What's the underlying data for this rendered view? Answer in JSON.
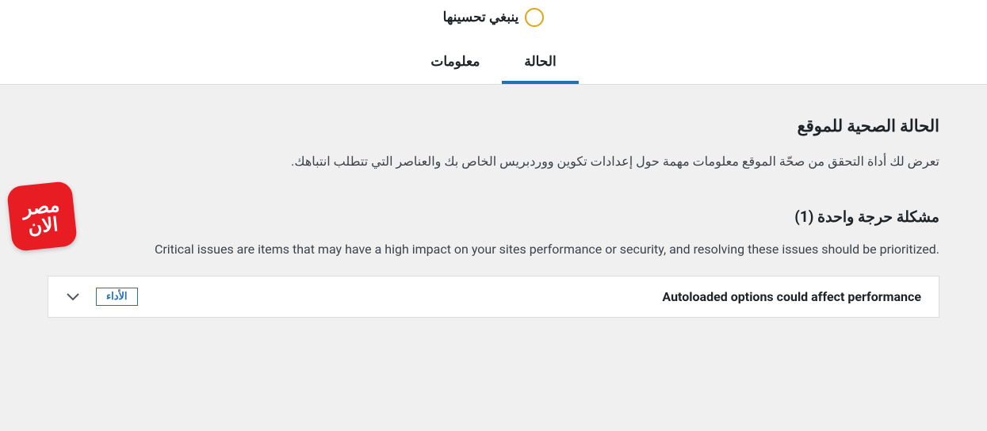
{
  "status": {
    "label": "ينبغي تحسينها"
  },
  "tabs": {
    "status": "الحالة",
    "info": "معلومات"
  },
  "siteHealth": {
    "title": "الحالة الصحية للموقع",
    "description": "تعرض لك أداة التحقق من صحّة الموقع معلومات مهمة حول إعدادات تكوين ووردبريس الخاص بك والعناصر التي تتطلب انتباهك."
  },
  "critical": {
    "title": "مشكلة حرجة واحدة (1)",
    "description": "Critical issues are items that may have a high impact on your sites performance or security, and resolving these issues should be prioritized."
  },
  "issue": {
    "title": "Autoloaded options could affect performance",
    "badge": "الأداء"
  },
  "logo": {
    "line1": "مصر",
    "line2": "الان"
  }
}
